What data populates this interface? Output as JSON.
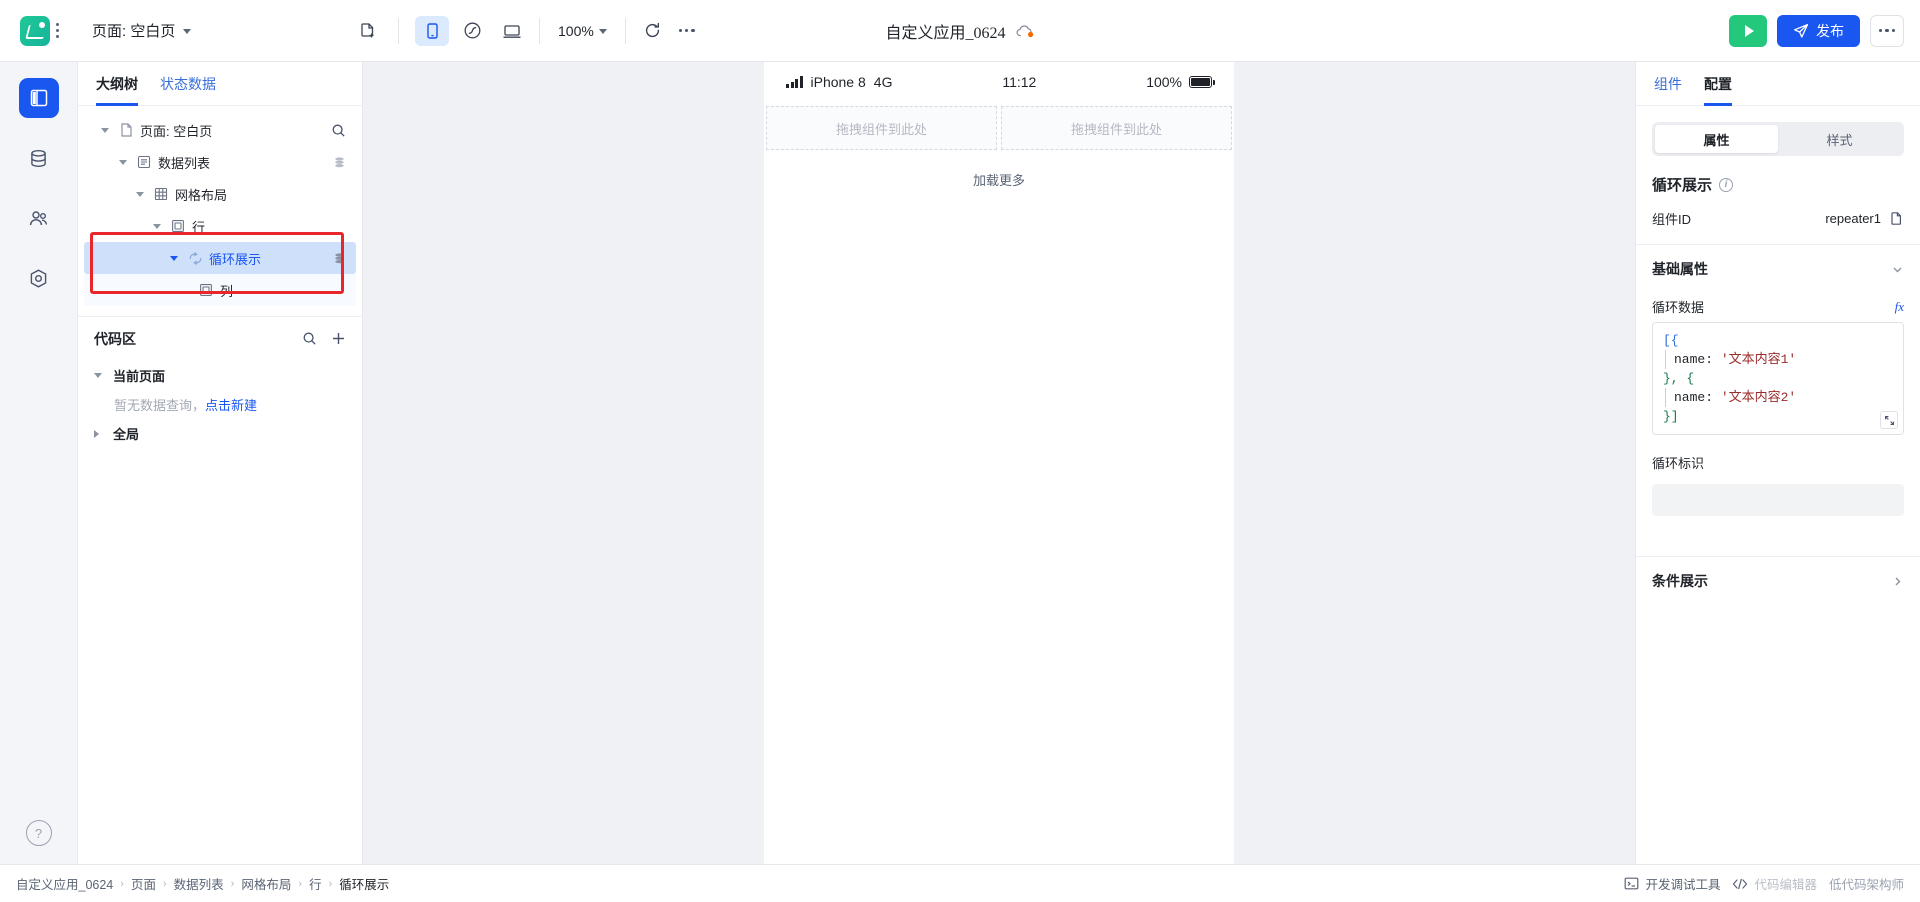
{
  "topbar": {
    "page_selector_label": "页面: 空白页",
    "new_page_icon": "new-file-icon",
    "devices": [
      {
        "name": "mobile",
        "icon": "mobile-icon",
        "active": true
      },
      {
        "name": "miniprogram",
        "icon": "wechat-icon",
        "active": false
      },
      {
        "name": "desktop",
        "icon": "desktop-icon",
        "active": false
      }
    ],
    "zoom_label": "100%",
    "refresh_icon": "refresh-icon",
    "more_icon": "ellipsis-icon",
    "doc_title": "自定义应用_0624",
    "cloud_icon": "cloud-sync-icon",
    "run_label": "run-button",
    "publish_label": "发布",
    "more_actions_label": "more-button"
  },
  "rail": {
    "items": [
      {
        "name": "pages-panel",
        "icon": "layout-icon",
        "active": true
      },
      {
        "name": "data-panel",
        "icon": "database-icon",
        "active": false
      },
      {
        "name": "users-panel",
        "icon": "users-icon",
        "active": false
      },
      {
        "name": "settings-panel",
        "icon": "target-icon",
        "active": false
      }
    ],
    "help_label": "?"
  },
  "left_panel": {
    "tabs": [
      {
        "label": "大纲树",
        "active": true
      },
      {
        "label": "状态数据",
        "active": false
      }
    ],
    "tree": [
      {
        "label": "页面: 空白页",
        "depth": 0,
        "icon": "file-icon",
        "caret": "down",
        "tail": "search-icon",
        "selected": false
      },
      {
        "label": "数据列表",
        "depth": 1,
        "icon": "list-icon",
        "caret": "down",
        "tail": "data-icon",
        "selected": false
      },
      {
        "label": "网格布局",
        "depth": 2,
        "icon": "grid-icon",
        "caret": "down",
        "tail": "",
        "selected": false
      },
      {
        "label": "行",
        "depth": 3,
        "icon": "row-icon",
        "caret": "down",
        "tail": "",
        "selected": false
      },
      {
        "label": "循环展示",
        "depth": 4,
        "icon": "loop-icon",
        "caret": "down",
        "tail": "data-icon",
        "selected": true
      },
      {
        "label": "列",
        "depth": 5,
        "icon": "column-icon",
        "caret": "none",
        "tail": "",
        "selected": false
      }
    ],
    "code_area": {
      "title": "代码区",
      "search_icon": "search-icon",
      "add_icon": "plus-icon",
      "groups": [
        {
          "label": "当前页面",
          "expanded": true
        },
        {
          "label": "全局",
          "expanded": false
        }
      ],
      "empty_text": "暂无数据查询，",
      "empty_link": "点击新建"
    }
  },
  "canvas": {
    "status_bar": {
      "signal_icon": "signal-icon",
      "carrier": "iPhone 8",
      "network": "4G",
      "time": "11:12",
      "battery_percent": "100%",
      "battery_icon": "battery-icon"
    },
    "dropzones": [
      "拖拽组件到此处",
      "拖拽组件到此处"
    ],
    "load_more": "加载更多"
  },
  "right_panel": {
    "tabs": [
      {
        "label": "组件",
        "active": false
      },
      {
        "label": "配置",
        "active": true
      }
    ],
    "segments": [
      {
        "label": "属性",
        "active": true
      },
      {
        "label": "样式",
        "active": false
      }
    ],
    "component_title": "循环展示",
    "info_icon": "info-icon",
    "component_id_label": "组件ID",
    "component_id_value": "repeater1",
    "copy_icon": "copy-icon",
    "basic_section_label": "基础属性",
    "loop_data_label": "循环数据",
    "fx_label": "fx",
    "loop_data_code": [
      {
        "t": "[{",
        "cls": "tk-b"
      },
      {
        "t": "name: ",
        "cls": "tk-k"
      },
      {
        "t": "'文本内容1'",
        "cls": "tk-s"
      },
      {
        "t": "}, {",
        "cls": "tk-br"
      },
      {
        "t": "name: ",
        "cls": "tk-k"
      },
      {
        "t": "'文本内容2'",
        "cls": "tk-s"
      },
      {
        "t": "}]",
        "cls": "tk-br"
      }
    ],
    "expand_icon": "expand-icon",
    "loop_key_label": "循环标识",
    "loop_key_value": "",
    "condition_section_label": "条件展示",
    "condition_chevron": "chevron-right-icon"
  },
  "bottom_bar": {
    "breadcrumbs": [
      "自定义应用_0624",
      "页面",
      "数据列表",
      "网格布局",
      "行",
      "循环展示"
    ],
    "devtools_label": "开发调试工具",
    "devtools_icon": "terminal-icon",
    "code_editor_label": "代码编辑器",
    "code_editor_icon": "code-icon",
    "watermark": "低代码架构师"
  },
  "colors": {
    "accent": "#1a56f0",
    "success": "#23c87d",
    "selection_border": "#e8262b",
    "selection_bg": "#cfe0fb"
  }
}
